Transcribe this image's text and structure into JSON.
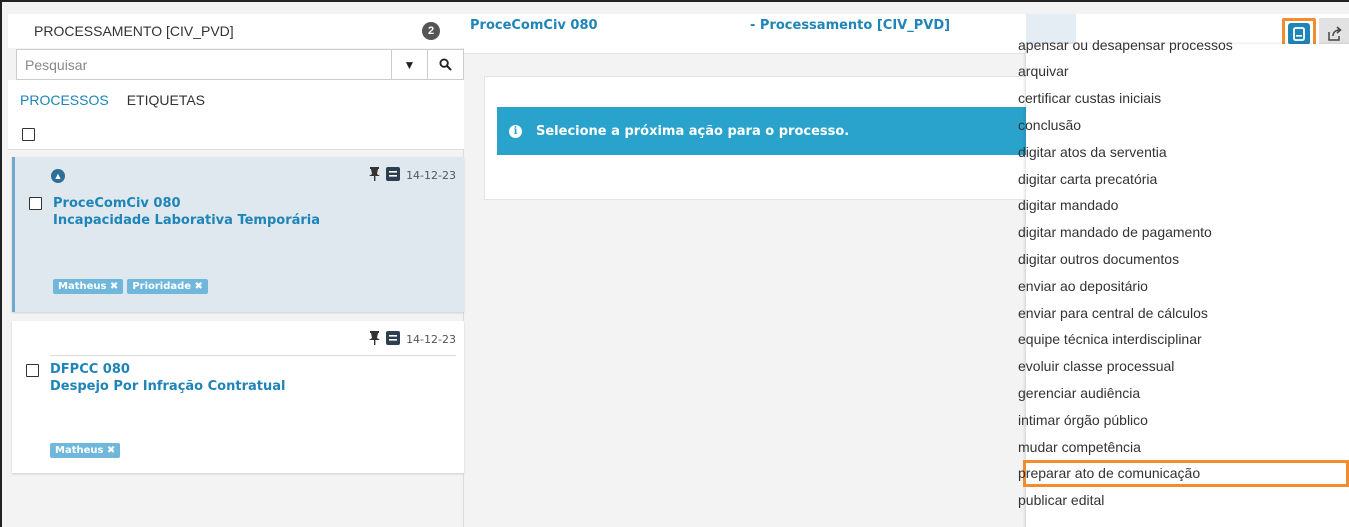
{
  "left_panel": {
    "title": "PROCESSAMENTO [CIV_PVD]",
    "count": "2",
    "search_placeholder": "Pesquisar",
    "tabs": [
      "PROCESSOS",
      "ETIQUETAS"
    ]
  },
  "cards": [
    {
      "number": "ProceComCiv 080",
      "subject": "Incapacidade Laborativa Temporária",
      "date": "14-12-23",
      "tags": [
        "Matheus ✖",
        "Prioridade ✖"
      ]
    },
    {
      "number": "DFPCC 080",
      "subject": "Despejo Por Infração Contratual",
      "date": "14-12-23",
      "tags": [
        "Matheus ✖"
      ]
    }
  ],
  "main": {
    "header_left": "ProceComCiv 080",
    "header_mid": "- Processamento [CIV_PVD]",
    "alert_text": "Selecione a próxima ação para o processo."
  },
  "dropdown": {
    "items": [
      "apensar ou desapensar processos",
      "arquivar",
      "certificar custas iniciais",
      "conclusão",
      "digitar atos da serventia",
      "digitar carta precatória",
      "digitar mandado",
      "digitar mandado de pagamento",
      "digitar outros documentos",
      "enviar ao depositário",
      "enviar para central de cálculos",
      "equipe técnica interdisciplinar",
      "evoluir classe processual",
      "gerenciar audiência",
      "intimar órgão público",
      "mudar competência",
      "preparar ato de comunicação",
      "publicar edital"
    ],
    "highlighted_index": 16
  },
  "colors": {
    "accent": "#1f84b7",
    "alert": "#2aa3cc",
    "highlight": "#f28c2d",
    "tag": "#6fb8dc"
  }
}
